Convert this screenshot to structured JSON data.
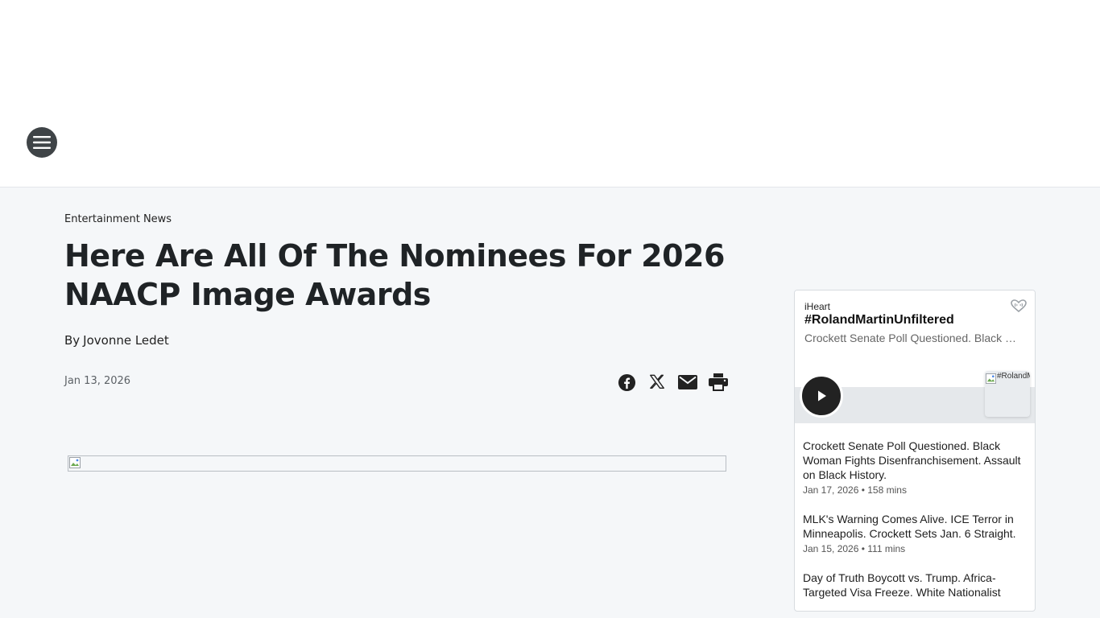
{
  "header": {
    "menu_icon": "hamburger-menu-icon"
  },
  "article": {
    "category": "Entertainment News",
    "title": "Here Are All Of The Nominees For 2026 NAACP Image Awards",
    "byline_prefix": "By",
    "author": "Jovonne Ledet",
    "date": "Jan 13, 2026",
    "share_icons": [
      "facebook-icon",
      "x-icon",
      "email-icon",
      "print-icon"
    ]
  },
  "widget": {
    "provider": "iHeart",
    "show_title": "#RolandMartinUnfiltered",
    "subtitle": "Crockett Senate Poll Questioned. Black Woman Fights Disenfranchisement. Assault on Black History.",
    "thumb_alt": "#RolandMartinUnfiltered",
    "episodes": [
      {
        "title": "Crockett Senate Poll Questioned. Black Woman Fights Disenfranchisement. Assault on Black History.",
        "meta": "Jan 17, 2026 • 158 mins"
      },
      {
        "title": "MLK's Warning Comes Alive. ICE Terror in Minneapolis. Crockett Sets Jan. 6 Straight.",
        "meta": "Jan 15, 2026 • 111 mins"
      },
      {
        "title": "Day of Truth Boycott vs. Trump. Africa-Targeted Visa Freeze. White Nationalist",
        "meta": ""
      }
    ]
  }
}
